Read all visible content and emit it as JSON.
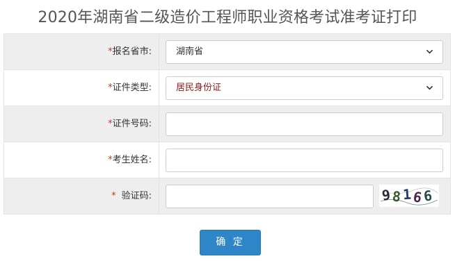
{
  "page": {
    "title": "2020年湖南省二级造价工程师职业资格考试准考证打印"
  },
  "form": {
    "required_mark": "*",
    "province": {
      "label": "报名省市:",
      "selected": "湖南省",
      "icon": "chevron-down-icon"
    },
    "id_type": {
      "label": "证件类型:",
      "selected": "居民身份证",
      "icon": "chevron-down-icon"
    },
    "id_number": {
      "label": "证件号码:",
      "value": ""
    },
    "candidate_name": {
      "label": "考生姓名:",
      "value": ""
    },
    "captcha": {
      "label": "验证码:",
      "value": "",
      "image_text": "98166"
    }
  },
  "actions": {
    "confirm_label": "确 定"
  },
  "colors": {
    "required": "#c0392b",
    "button": "#2e86c8",
    "row_shade": "#eeeeee",
    "selected_id_type": "#8b1a1a"
  }
}
